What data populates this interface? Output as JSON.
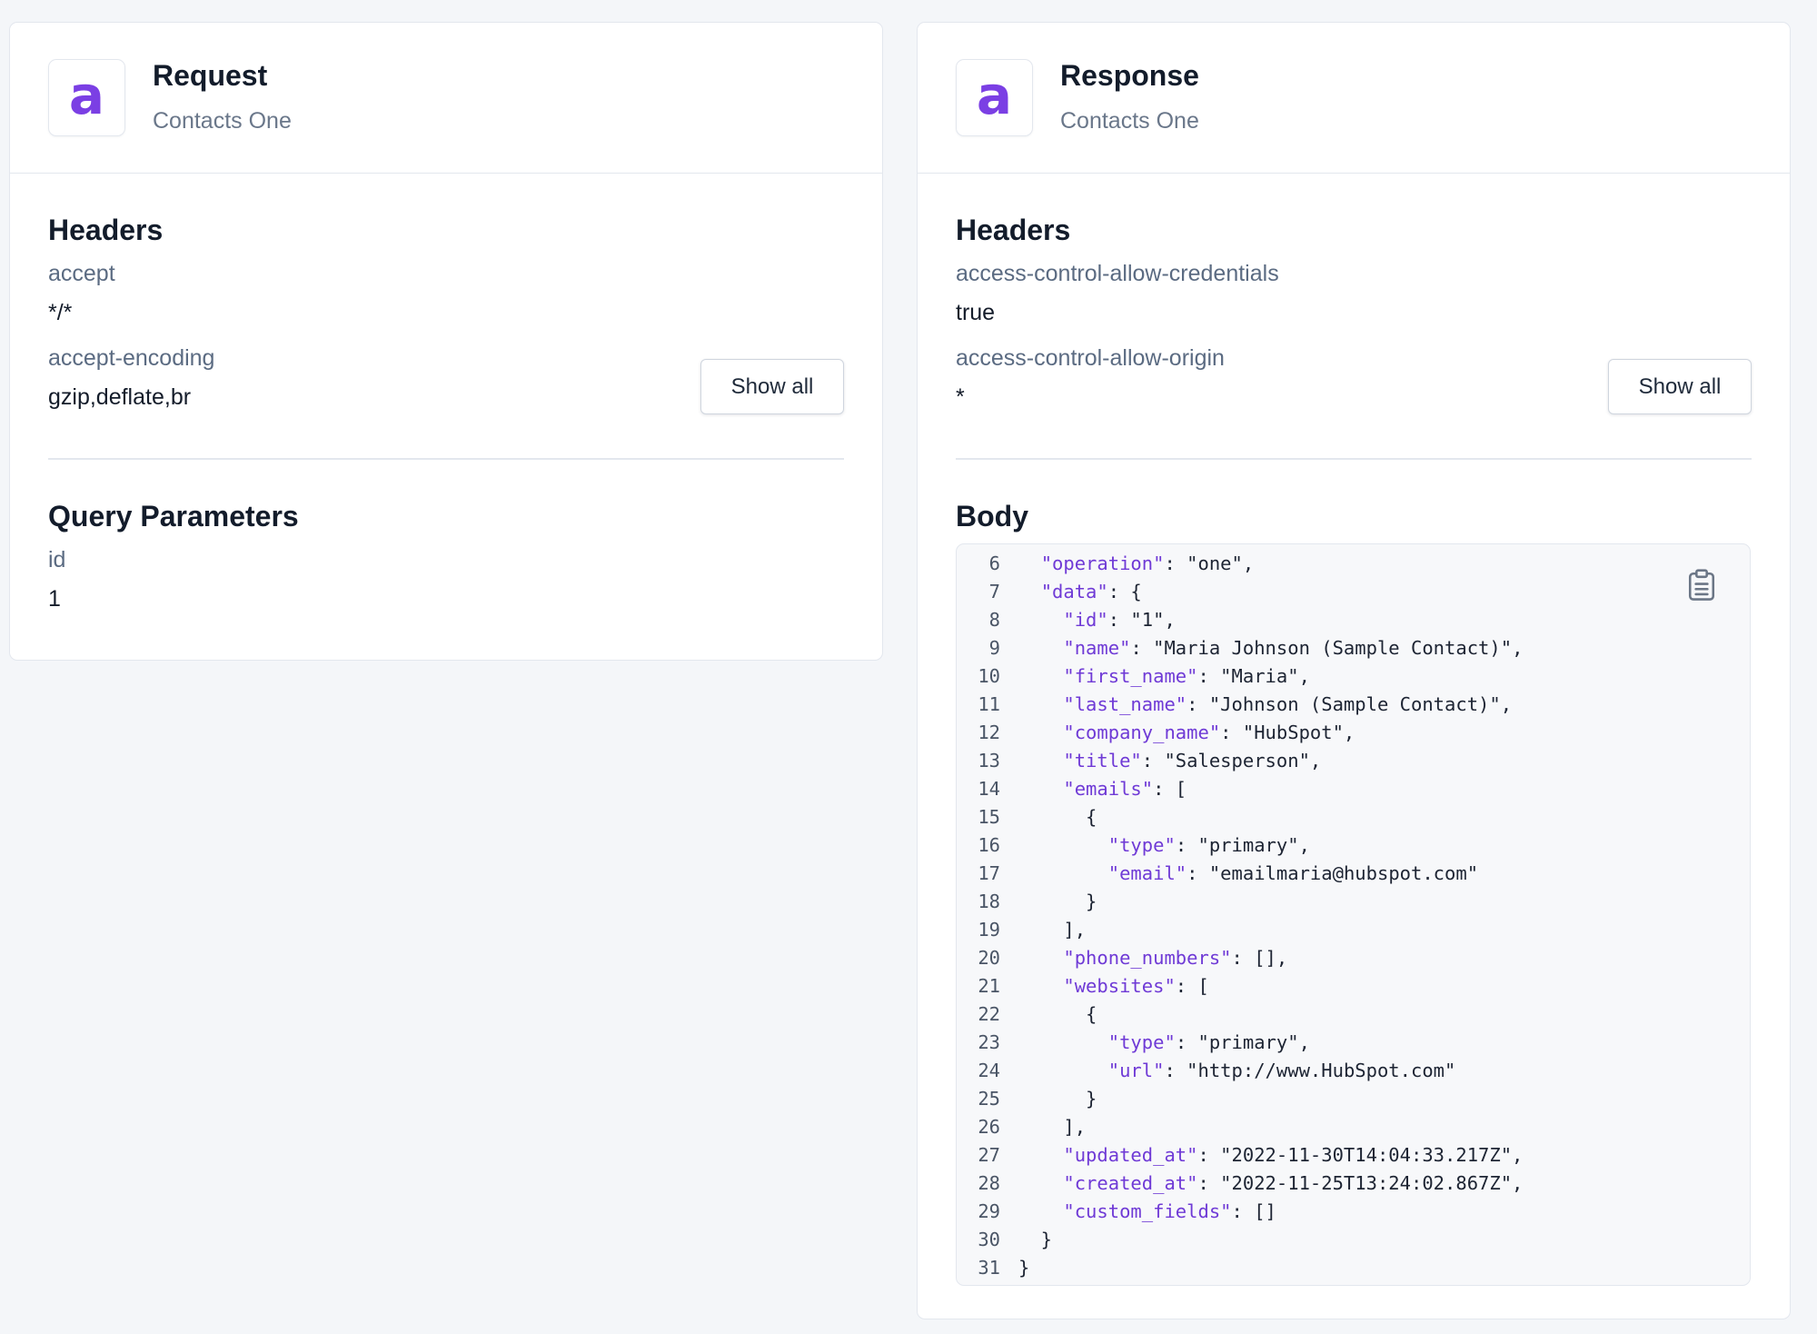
{
  "request": {
    "title": "Request",
    "subtitle": "Contacts One",
    "logo_letter": "a",
    "headers_title": "Headers",
    "headers": [
      {
        "key": "accept",
        "value": "*/*"
      },
      {
        "key": "accept-encoding",
        "value": "gzip,deflate,br"
      }
    ],
    "show_all_label": "Show all",
    "query_title": "Query Parameters",
    "query_params": [
      {
        "key": "id",
        "value": "1"
      }
    ]
  },
  "response": {
    "title": "Response",
    "subtitle": "Contacts One",
    "logo_letter": "a",
    "headers_title": "Headers",
    "headers": [
      {
        "key": "access-control-allow-credentials",
        "value": "true"
      },
      {
        "key": "access-control-allow-origin",
        "value": "*"
      }
    ],
    "show_all_label": "Show all",
    "body_title": "Body",
    "body_lines": [
      {
        "n": "6",
        "text": "  \"operation\": \"one\","
      },
      {
        "n": "7",
        "text": "  \"data\": {"
      },
      {
        "n": "8",
        "text": "    \"id\": \"1\","
      },
      {
        "n": "9",
        "text": "    \"name\": \"Maria Johnson (Sample Contact)\","
      },
      {
        "n": "10",
        "text": "    \"first_name\": \"Maria\","
      },
      {
        "n": "11",
        "text": "    \"last_name\": \"Johnson (Sample Contact)\","
      },
      {
        "n": "12",
        "text": "    \"company_name\": \"HubSpot\","
      },
      {
        "n": "13",
        "text": "    \"title\": \"Salesperson\","
      },
      {
        "n": "14",
        "text": "    \"emails\": ["
      },
      {
        "n": "15",
        "text": "      {"
      },
      {
        "n": "16",
        "text": "        \"type\": \"primary\","
      },
      {
        "n": "17",
        "text": "        \"email\": \"emailmaria@hubspot.com\""
      },
      {
        "n": "18",
        "text": "      }"
      },
      {
        "n": "19",
        "text": "    ],"
      },
      {
        "n": "20",
        "text": "    \"phone_numbers\": [],"
      },
      {
        "n": "21",
        "text": "    \"websites\": ["
      },
      {
        "n": "22",
        "text": "      {"
      },
      {
        "n": "23",
        "text": "        \"type\": \"primary\","
      },
      {
        "n": "24",
        "text": "        \"url\": \"http://www.HubSpot.com\""
      },
      {
        "n": "25",
        "text": "      }"
      },
      {
        "n": "26",
        "text": "    ],"
      },
      {
        "n": "27",
        "text": "    \"updated_at\": \"2022-11-30T14:04:33.217Z\","
      },
      {
        "n": "28",
        "text": "    \"created_at\": \"2022-11-25T13:24:02.867Z\","
      },
      {
        "n": "29",
        "text": "    \"custom_fields\": []"
      },
      {
        "n": "30",
        "text": "  }"
      },
      {
        "n": "31",
        "text": "}"
      }
    ],
    "copy_icon": "clipboard-icon"
  },
  "colors": {
    "brand": "#7b3fe4",
    "json_key": "#6f3ad6"
  }
}
